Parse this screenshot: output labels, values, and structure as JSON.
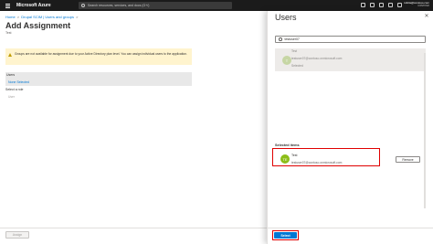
{
  "topbar": {
    "brand": "Microsoft Azure",
    "search_placeholder": "Search resources, services, and docs (G+/)",
    "user_line1": "rolicla@contoso.com",
    "user_line2": "CONTOSO"
  },
  "breadcrumb": {
    "items": [
      "Home",
      "Drupal SCIM | Users and groups"
    ],
    "separator": ">"
  },
  "page": {
    "title": "Add Assignment",
    "subtitle": "Test"
  },
  "warning": {
    "text": "Groups are not available for assignment due to your Active Directory plan level. You can assign individual users to the application."
  },
  "users_section": {
    "label": "Users",
    "value": "None Selected"
  },
  "role_section": {
    "label": "Select a role",
    "value": "User"
  },
  "assign_button": "Assign",
  "panel": {
    "title": "Users",
    "close_glyph": "✕",
    "search_value": "testuser07",
    "result": {
      "initials": "T",
      "name": "Test",
      "email": "testuser07@contoso.onmicrosoft.com",
      "status": "Selected"
    },
    "selected_heading": "Selected items",
    "selected_item": {
      "initials": "TE",
      "name": "Test",
      "email": "testuser07@contoso.onmicrosoft.com"
    },
    "remove_label": "Remove",
    "select_label": "Select"
  },
  "colors": {
    "topbar": "#1b1b1b",
    "accent": "#0078d4",
    "warning_bg": "#fff4ce",
    "highlight_border": "#e00000",
    "avatar": "#8cbd18"
  }
}
